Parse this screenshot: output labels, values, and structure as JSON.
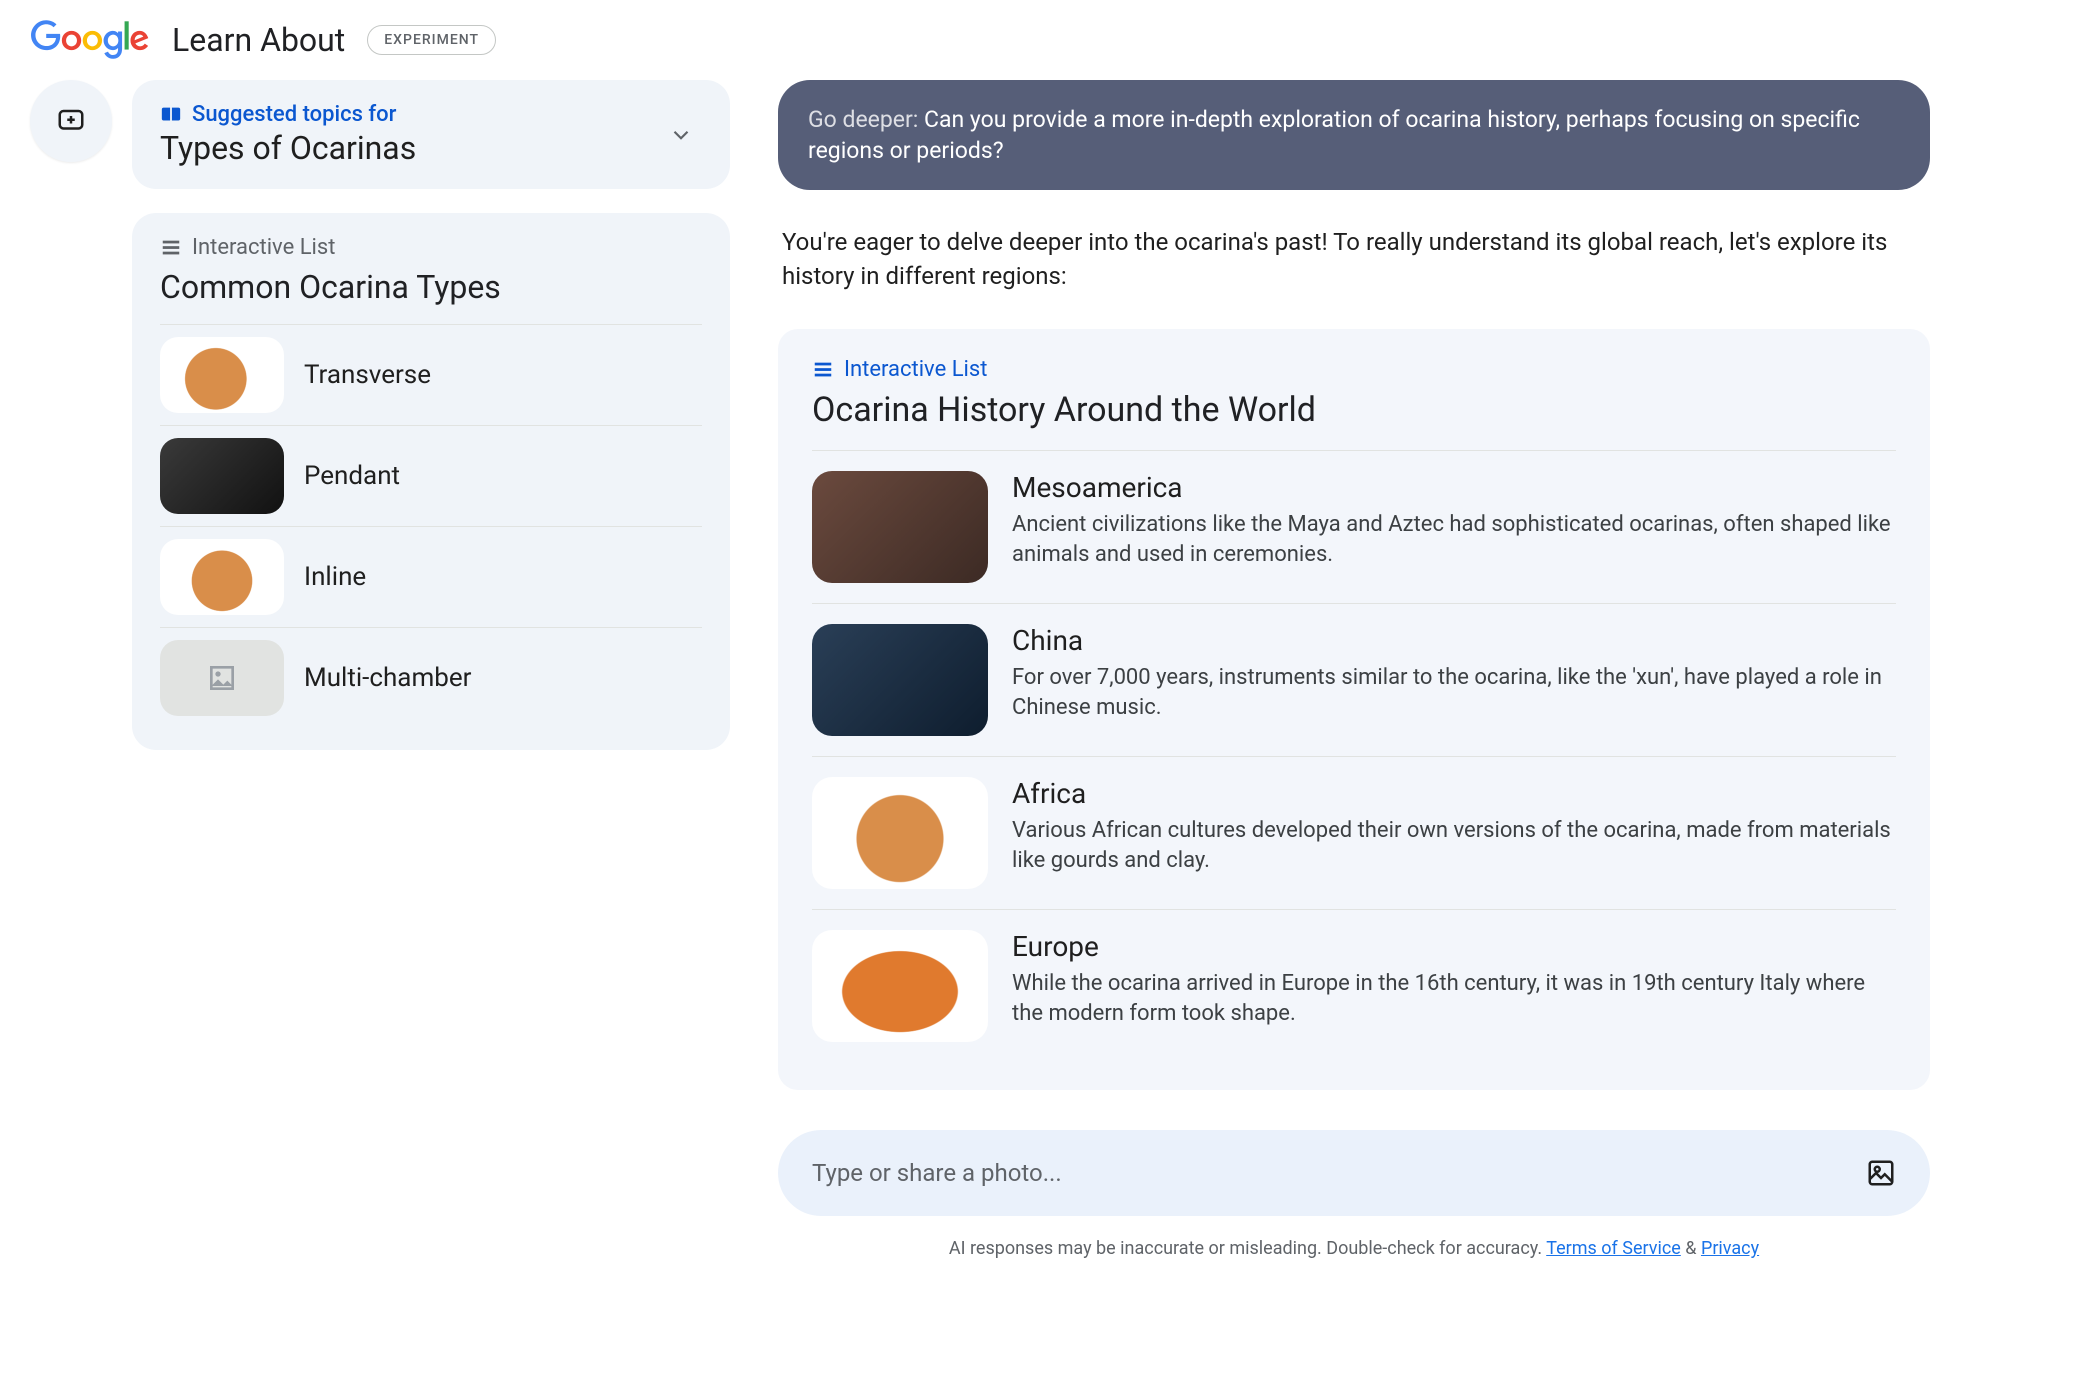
{
  "header": {
    "app_name": "Learn About",
    "badge": "EXPERIMENT"
  },
  "sidebar": {
    "suggested": {
      "label": "Suggested topics for",
      "title": "Types of Ocarinas"
    },
    "list": {
      "label": "Interactive List",
      "title": "Common Ocarina Types",
      "items": [
        {
          "name": "Transverse",
          "placeholder": false
        },
        {
          "name": "Pendant",
          "placeholder": false
        },
        {
          "name": "Inline",
          "placeholder": false
        },
        {
          "name": "Multi-chamber",
          "placeholder": true
        }
      ]
    }
  },
  "chat": {
    "go_deeper": {
      "label": "Go deeper: ",
      "text": "Can you provide a more in-depth exploration of ocarina history, perhaps focusing on specific regions or periods?"
    },
    "intro": "You're eager to delve deeper into the ocarina's past! To really understand its global reach, let's explore its history in different regions:",
    "world": {
      "label": "Interactive List",
      "title": "Ocarina History Around the World",
      "items": [
        {
          "title": "Mesoamerica",
          "desc": "Ancient civilizations like the Maya and Aztec had sophisticated ocarinas, often shaped like animals and used in ceremonies."
        },
        {
          "title": "China",
          "desc": "For over 7,000 years, instruments similar to the ocarina, like the 'xun', have played a role in Chinese music."
        },
        {
          "title": "Africa",
          "desc": "Various African cultures developed their own versions of the ocarina, made from materials like gourds and clay."
        },
        {
          "title": "Europe",
          "desc": "While the ocarina arrived in Europe in the 16th century, it was in 19th century Italy where the modern form took shape."
        }
      ]
    },
    "input_placeholder": "Type or share a photo..."
  },
  "footer": {
    "disclaimer": "AI responses may be inaccurate or misleading. Double-check for accuracy. ",
    "terms": "Terms of Service",
    "amp": " & ",
    "privacy": "Privacy"
  }
}
